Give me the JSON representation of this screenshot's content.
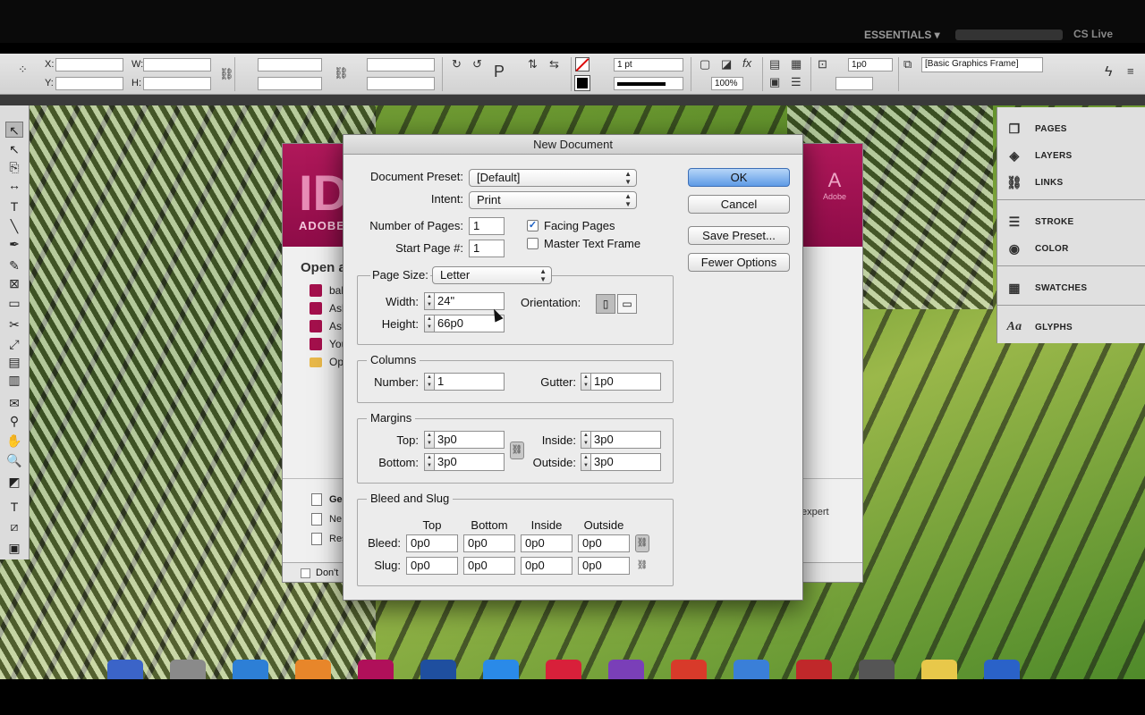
{
  "topbar": {
    "workspace": "ESSENTIALS ▾",
    "cs_live": "CS Live"
  },
  "control": {
    "x_label": "X:",
    "y_label": "Y:",
    "w_label": "W:",
    "h_label": "H:",
    "stroke_weight": "1 pt",
    "zoom": "100%",
    "offset": "1p0",
    "object_style": "[Basic Graphics Frame]"
  },
  "tools": [
    {
      "name": "selection-tool-icon",
      "glyph": "↖"
    },
    {
      "name": "direct-selection-tool-icon",
      "glyph": "↖"
    },
    {
      "name": "page-tool-icon",
      "glyph": "⎘"
    },
    {
      "name": "gap-tool-icon",
      "glyph": "↔"
    },
    {
      "name": "type-tool-icon",
      "glyph": "T"
    },
    {
      "name": "line-tool-icon",
      "glyph": "╲"
    },
    {
      "name": "pen-tool-icon",
      "glyph": "✒"
    },
    {
      "name": "pencil-tool-icon",
      "glyph": "✎"
    },
    {
      "name": "rectangle-frame-tool-icon",
      "glyph": "⊠"
    },
    {
      "name": "rectangle-tool-icon",
      "glyph": "▭"
    },
    {
      "name": "scissors-tool-icon",
      "glyph": "✂"
    },
    {
      "name": "free-transform-tool-icon",
      "glyph": "⤢"
    },
    {
      "name": "gradient-swatch-tool-icon",
      "glyph": "▤"
    },
    {
      "name": "gradient-feather-tool-icon",
      "glyph": "▥"
    },
    {
      "name": "note-tool-icon",
      "glyph": "✉"
    },
    {
      "name": "eyedropper-tool-icon",
      "glyph": "⚲"
    },
    {
      "name": "hand-tool-icon",
      "glyph": "✋"
    },
    {
      "name": "zoom-tool-icon",
      "glyph": "🔍"
    },
    {
      "name": "fill-stroke-icon",
      "glyph": "◩"
    },
    {
      "name": "formatting-icon",
      "glyph": "T"
    },
    {
      "name": "apply-none-icon",
      "glyph": "⧄"
    },
    {
      "name": "screen-mode-icon",
      "glyph": "▣"
    }
  ],
  "panels": {
    "pages": "PAGES",
    "layers": "LAYERS",
    "links": "LINKS",
    "stroke": "STROKE",
    "color": "COLOR",
    "swatches": "SWATCHES",
    "glyphs": "GLYPHS"
  },
  "welcome": {
    "logo": "ID",
    "adobe": "ADOBE",
    "adobe_mark": "Adobe",
    "open_title": "Open a",
    "recent": [
      "bal",
      "Ash",
      "Ash",
      "You",
      "Op"
    ],
    "create": [
      "Ge",
      "Ne",
      "Res"
    ],
    "expert": "expert",
    "dont_show": "Don't"
  },
  "dialog": {
    "title": "New Document",
    "preset_label": "Document Preset:",
    "preset_value": "[Default]",
    "intent_label": "Intent:",
    "intent_value": "Print",
    "num_pages_label": "Number of Pages:",
    "num_pages_value": "1",
    "start_page_label": "Start Page #:",
    "start_page_value": "1",
    "facing_pages": "Facing Pages",
    "master_text_frame": "Master Text Frame",
    "ok": "OK",
    "cancel": "Cancel",
    "save_preset": "Save Preset...",
    "fewer_options": "Fewer Options",
    "page_size_label": "Page Size:",
    "page_size_value": "Letter",
    "width_label": "Width:",
    "width_value": "24\"",
    "height_label": "Height:",
    "height_value": "66p0",
    "orientation_label": "Orientation:",
    "columns_title": "Columns",
    "number_label": "Number:",
    "number_value": "1",
    "gutter_label": "Gutter:",
    "gutter_value": "1p0",
    "margins_title": "Margins",
    "top_label": "Top:",
    "top_value": "3p0",
    "bottom_label": "Bottom:",
    "bottom_value": "3p0",
    "inside_label": "Inside:",
    "inside_value": "3p0",
    "outside_label": "Outside:",
    "outside_value": "3p0",
    "bleed_slug_title": "Bleed and Slug",
    "col_top": "Top",
    "col_bottom": "Bottom",
    "col_inside": "Inside",
    "col_outside": "Outside",
    "bleed_label": "Bleed:",
    "slug_label": "Slug:",
    "bleed": [
      "0p0",
      "0p0",
      "0p0",
      "0p0"
    ],
    "slug": [
      "0p0",
      "0p0",
      "0p0",
      "0p0"
    ]
  },
  "dock_colors": [
    "#3b64c8",
    "#8a8a8a",
    "#2d7fd6",
    "#e8862a",
    "#b0105a",
    "#1f4f9f",
    "#2a8ae8",
    "#d8203a",
    "#7a3fb8",
    "#d83a2a",
    "#3a7fd8",
    "#c0282a",
    "#555",
    "#e8c84a",
    "#2a62c8"
  ]
}
